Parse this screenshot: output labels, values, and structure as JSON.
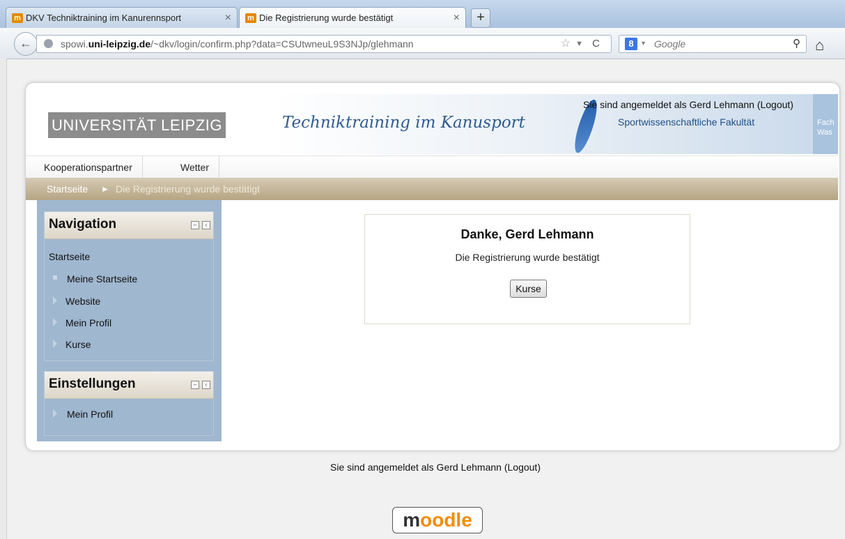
{
  "browser": {
    "tabs": [
      {
        "title": "DKV Techniktraining im Kanurennsport",
        "favicon": "moodle-favicon",
        "active": false,
        "close": "×"
      },
      {
        "title": "Die Registrierung wurde bestätigt",
        "favicon": "moodle-favicon",
        "active": true,
        "close": "×"
      }
    ],
    "new_tab": "+",
    "favicon_glyph": "m",
    "back_icon": "←",
    "url_prefix": "spowi.",
    "url_domain": "uni-leipzig.de",
    "url_path": "/~dkv/login/confirm.php?data=CSUtwneuL9S3NJp/glehmann",
    "star_icon": "☆",
    "dropdown_icon": "▼",
    "reload_icon": "C",
    "search_engine_icon": "8",
    "search_dropdown": "▾",
    "search_placeholder": "Google",
    "search_icon": "⚲",
    "home_icon": "⌂"
  },
  "header": {
    "logo": "UNIVERSITÄT LEIPZIG",
    "tagline": "Techniktraining im Kanusport",
    "faculty": "Sportwissenschaftliche Fakultät",
    "login_info": "Sie sind angemeldet als Gerd Lehmann (Logout)",
    "fach_1": "Fach",
    "fach_2": "Was"
  },
  "menu": [
    {
      "label": "Kooperationspartner"
    },
    {
      "label": "Wetter"
    }
  ],
  "breadcrumb": {
    "home": "Startseite",
    "separator": "►",
    "current": "Die Registrierung wurde bestätigt"
  },
  "sidebar": {
    "navigation": {
      "title": "Navigation",
      "root": "Startseite",
      "items": [
        "Meine Startseite",
        "Website",
        "Mein Profil",
        "Kurse"
      ]
    },
    "settings": {
      "title": "Einstellungen",
      "items": [
        "Mein Profil"
      ]
    },
    "collapse_icon": "–",
    "dock_icon": "‹"
  },
  "main": {
    "heading": "Danke, Gerd Lehmann",
    "message": "Die Registrierung wurde bestätigt",
    "button": "Kurse"
  },
  "footer": {
    "login_info": "Sie sind angemeldet als Gerd Lehmann (Logout)",
    "logo_m": "m",
    "logo_text": "oodle"
  }
}
